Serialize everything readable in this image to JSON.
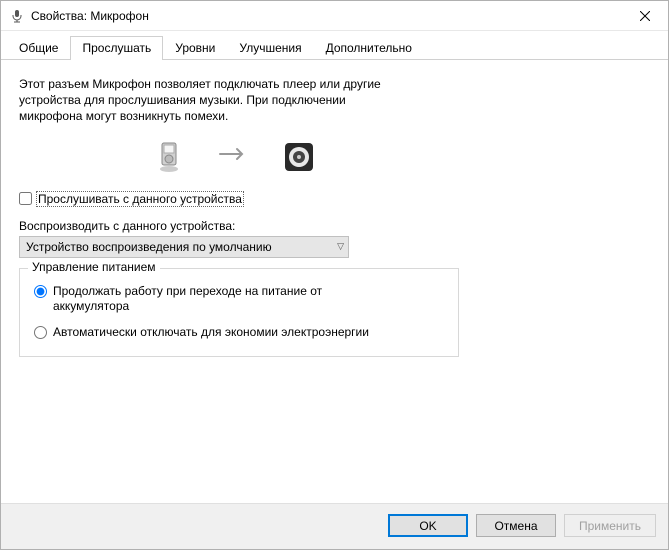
{
  "window": {
    "title": "Свойства: Микрофон"
  },
  "tabs": {
    "general": "Общие",
    "listen": "Прослушать",
    "levels": "Уровни",
    "enhancements": "Улучшения",
    "advanced": "Дополнительно"
  },
  "listen_tab": {
    "description_line1": "Этот разъем Микрофон позволяет подключать плеер или другие",
    "description_line2": "устройства для прослушивания музыки. При подключении",
    "description_line3": "микрофона могут возникнуть помехи.",
    "listen_checkbox_label": "Прослушивать с данного устройства",
    "listen_checkbox_checked": false,
    "playback_label": "Воспроизводить с данного устройства:",
    "playback_selected": "Устройство воспроизведения по умолчанию",
    "power_group_title": "Управление питанием",
    "radio_continue": "Продолжать работу при переходе на питание от аккумулятора",
    "radio_auto_off": "Автоматически отключать для экономии электроэнергии",
    "radio_selected": "continue"
  },
  "buttons": {
    "ok": "OK",
    "cancel": "Отмена",
    "apply": "Применить"
  }
}
